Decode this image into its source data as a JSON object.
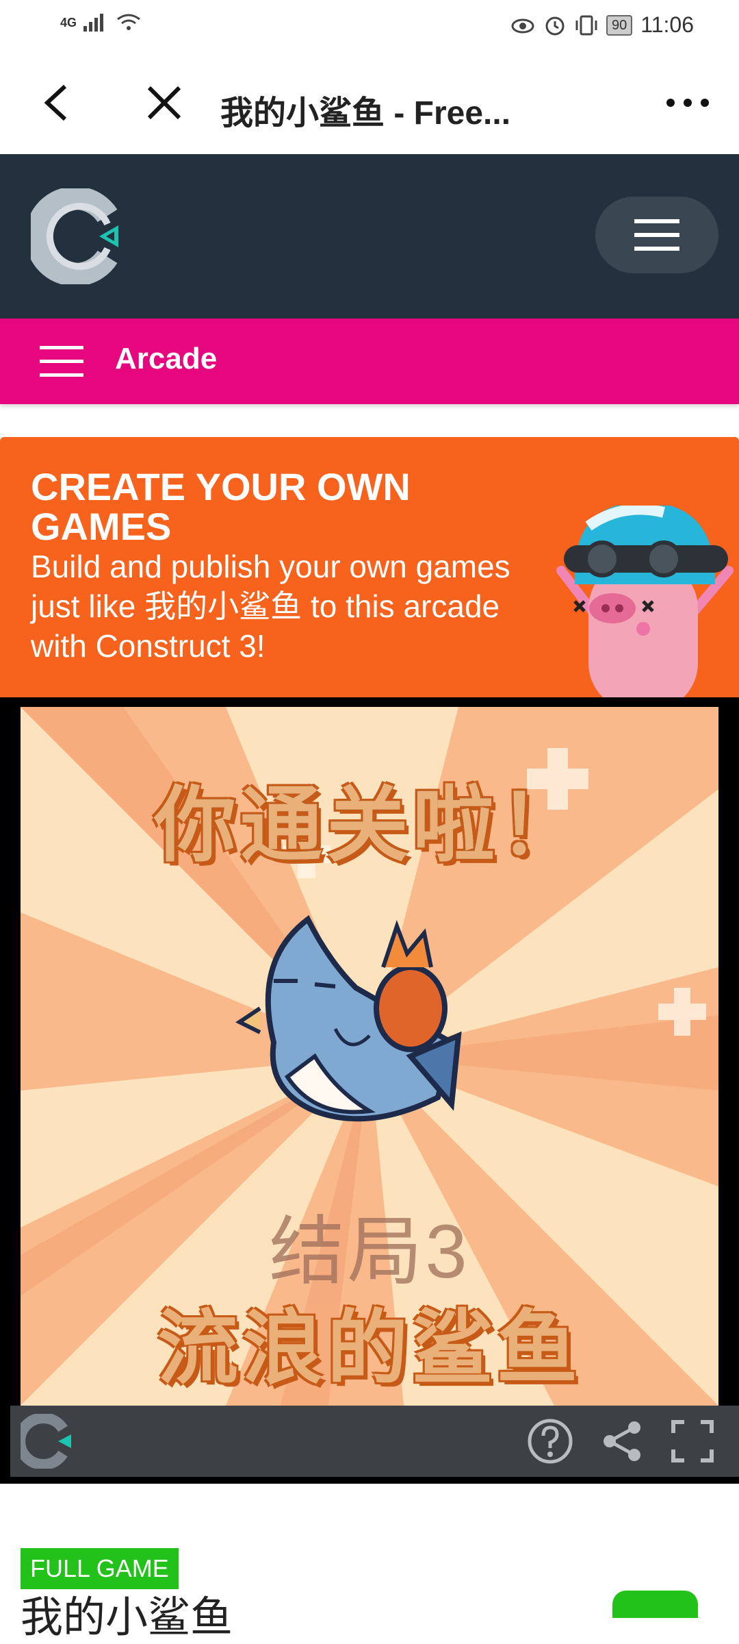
{
  "status_bar": {
    "network": "4G",
    "battery": "90",
    "time": "11:06"
  },
  "browser": {
    "title": "我的小鲨鱼 - Free..."
  },
  "nav": {
    "category": "Arcade"
  },
  "promo": {
    "title": "CREATE YOUR OWN GAMES",
    "text": "Build and publish your own games just like 我的小鲨鱼 to this arcade with Construct 3!"
  },
  "game": {
    "line1": "你通关啦！",
    "line2": "结局3",
    "line3": "流浪的鲨鱼"
  },
  "info": {
    "badge": "FULL GAME",
    "title": "我的小鲨鱼"
  },
  "colors": {
    "header_bg": "#23313f",
    "nav_pink": "#e6077f",
    "promo_orange": "#f7621c",
    "badge_green": "#22c21b"
  }
}
